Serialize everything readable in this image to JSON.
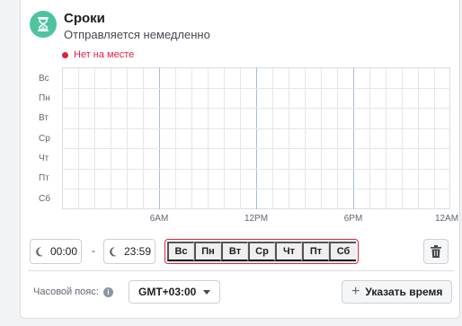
{
  "header": {
    "title": "Сроки",
    "subtitle": "Отправляется немедленно",
    "icon": "hourglass-icon",
    "icon_bg": "#4fc3a1"
  },
  "status": {
    "label": "Нет на месте",
    "color": "#e41e3f"
  },
  "schedule": {
    "days": [
      "Вс",
      "Пн",
      "Вт",
      "Ср",
      "Чт",
      "Пт",
      "Сб"
    ],
    "time_labels": [
      "6AM",
      "12PM",
      "6PM",
      "12AM"
    ]
  },
  "time_range": {
    "start": "00:00",
    "end": "23:59",
    "separator": "-"
  },
  "day_buttons": [
    "Вс",
    "Пн",
    "Вт",
    "Ср",
    "Чт",
    "Пт",
    "Сб"
  ],
  "timezone": {
    "label": "Часовой пояс:",
    "value": "GMT+03:00"
  },
  "actions": {
    "set_time_label": "Указать время",
    "delete_icon": "trash-icon"
  }
}
